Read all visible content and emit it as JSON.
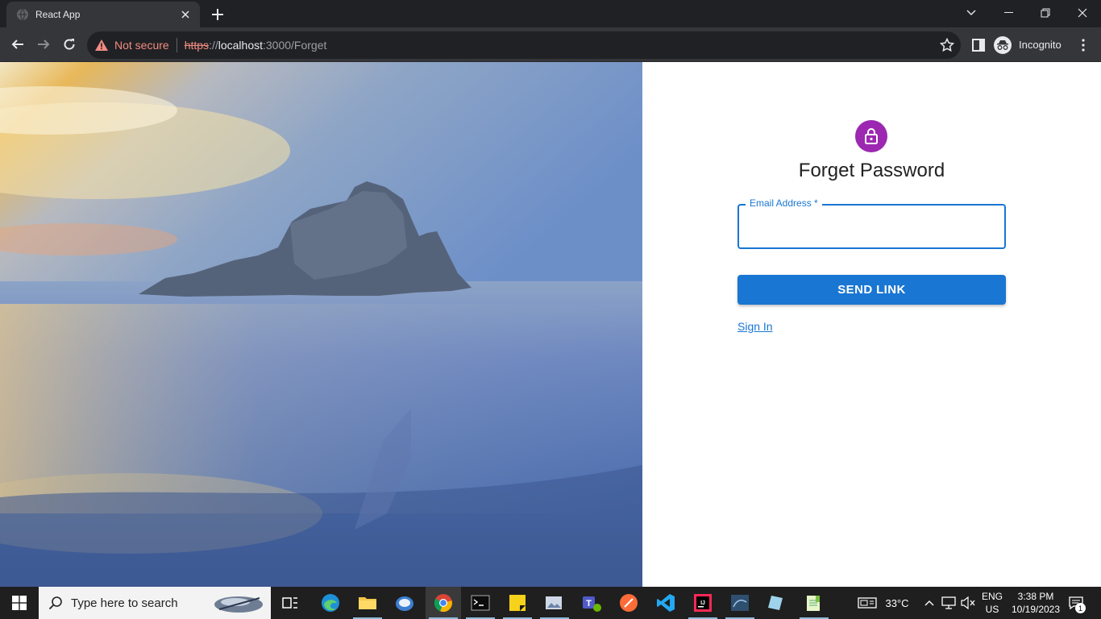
{
  "browser": {
    "tab_title": "React App",
    "security_label": "Not secure",
    "url_scheme": "https",
    "url_sep": "://",
    "url_host": "localhost",
    "url_rest": ":3000/Forget",
    "profile_label": "Incognito"
  },
  "form": {
    "title": "Forget Password",
    "email_label": "Email Address *",
    "email_value": "",
    "submit_label": "SEND LINK",
    "signin_link": "Sign In"
  },
  "taskbar": {
    "search_placeholder": "Type here to search",
    "weather": "33°C",
    "lang_top": "ENG",
    "lang_bottom": "US",
    "time": "3:38 PM",
    "date": "10/19/2023",
    "notification_count": "1"
  },
  "colors": {
    "accent": "#1976d2",
    "avatar": "#9c27b0",
    "warning": "#f28b82"
  }
}
